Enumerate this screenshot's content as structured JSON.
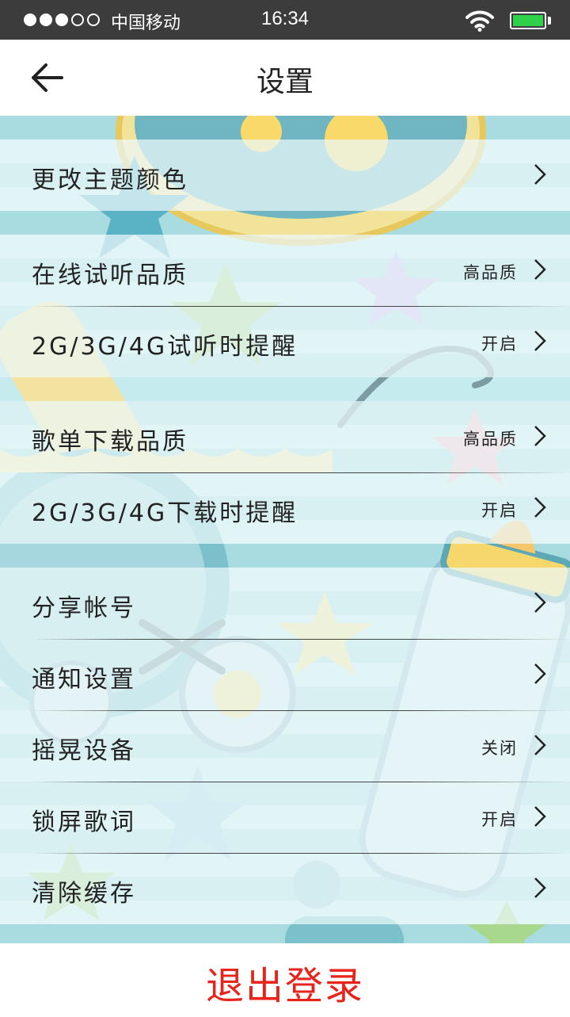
{
  "status_bar": {
    "carrier": "中国移动",
    "time": "16:34",
    "signal_bars_filled": 3,
    "signal_bars_total": 5,
    "battery_color": "#2fd04a"
  },
  "header": {
    "title": "设置",
    "back_icon": "arrow-left-icon"
  },
  "settings": {
    "theme": {
      "label": "更改主题颜色",
      "value": ""
    },
    "listen_quality": {
      "label": "在线试听品质",
      "value": "高品质"
    },
    "listen_network_alert": {
      "label": "2G/3G/4G试听时提醒",
      "value": "开启"
    },
    "download_quality": {
      "label": "歌单下载品质",
      "value": "高品质"
    },
    "download_network_alert": {
      "label": "2G/3G/4G下载时提醒",
      "value": "开启"
    },
    "share_account": {
      "label": "分享帐号",
      "value": ""
    },
    "notification": {
      "label": "通知设置",
      "value": ""
    },
    "shake": {
      "label": "摇晃设备",
      "value": "关闭"
    },
    "lock_lyrics": {
      "label": "锁屏歌词",
      "value": "开启"
    },
    "clear_cache": {
      "label": "清除缓存",
      "value": ""
    }
  },
  "logout": {
    "label": "退出登录"
  },
  "colors": {
    "logout_text": "#e8231c",
    "status_bar_bg": "#3c3c3c",
    "background_stripe_dark": "#a9dce0",
    "background_stripe_light": "#c6ebee"
  }
}
